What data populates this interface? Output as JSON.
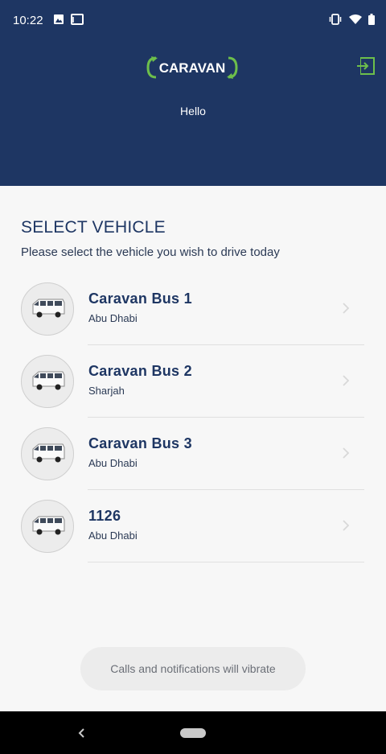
{
  "status_bar": {
    "time": "10:22",
    "left_icons": [
      "image-icon",
      "gmail-icon"
    ],
    "right_icons": [
      "vibrate-icon",
      "wifi-icon",
      "battery-icon"
    ]
  },
  "header": {
    "logo_text": "CARAVAN",
    "greeting": "Hello",
    "logout_icon": "exit-icon",
    "colors": {
      "header_bg": "#1e3663",
      "accent": "#6dbf4b"
    }
  },
  "main": {
    "title": "SELECT VEHICLE",
    "subtitle": "Please select the vehicle you wish to drive today",
    "vehicles": [
      {
        "name": "Caravan Bus 1",
        "location": "Abu Dhabi"
      },
      {
        "name": "Caravan Bus 2",
        "location": "Sharjah"
      },
      {
        "name": "Caravan Bus 3",
        "location": "Abu Dhabi"
      },
      {
        "name": "1126",
        "location": "Abu Dhabi"
      }
    ]
  },
  "toast": {
    "text": "Calls and notifications will vibrate"
  },
  "nav": {
    "back_icon": "back-chevron-icon",
    "home_icon": "home-pill-icon"
  }
}
